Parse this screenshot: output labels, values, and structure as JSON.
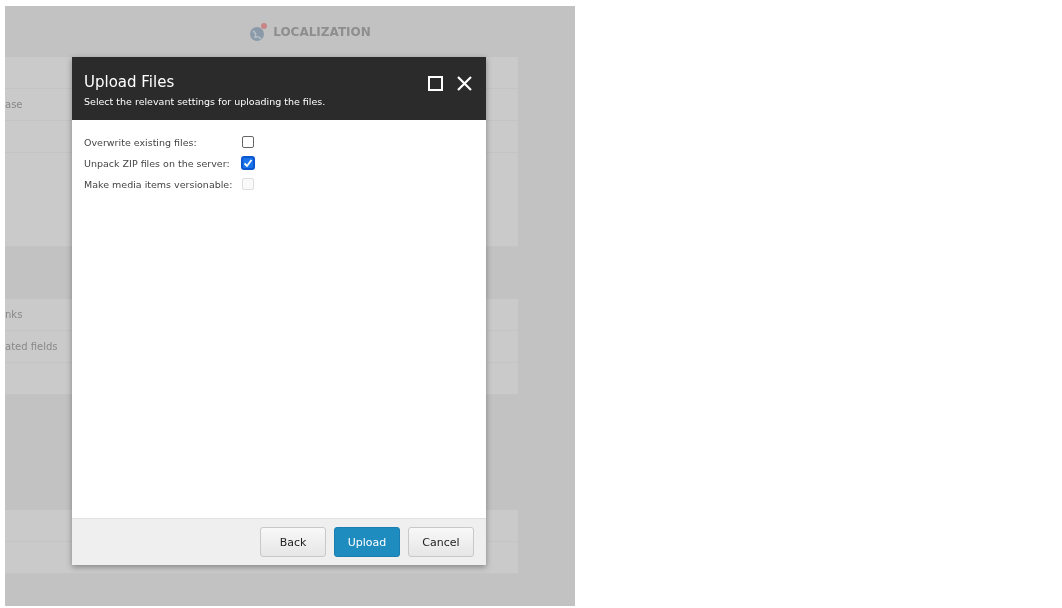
{
  "background": {
    "heading": "LOCALIZATION",
    "row_labels": [
      "ase",
      "nks",
      "ated fields"
    ]
  },
  "dialog": {
    "title": "Upload Files",
    "subtitle": "Select the relevant settings for uploading the files.",
    "options": [
      {
        "label": "Overwrite existing files:",
        "checked": false,
        "disabled": false
      },
      {
        "label": "Unpack ZIP files on the server:",
        "checked": true,
        "disabled": false
      },
      {
        "label": "Make media items versionable:",
        "checked": false,
        "disabled": true
      }
    ],
    "buttons": [
      {
        "label": "Back",
        "primary": false
      },
      {
        "label": "Upload",
        "primary": true
      },
      {
        "label": "Cancel",
        "primary": false
      }
    ]
  }
}
